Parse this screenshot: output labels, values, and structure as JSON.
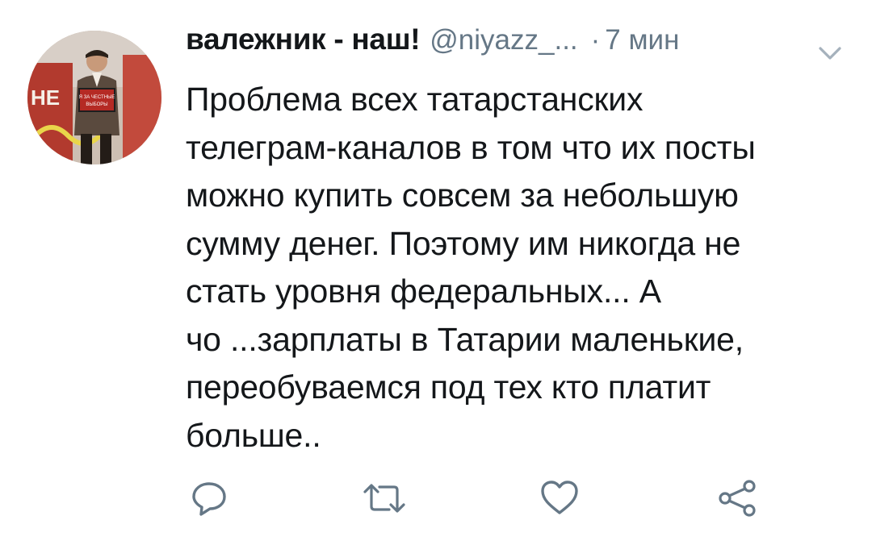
{
  "tweet": {
    "author_name": "валежник - наш!",
    "author_handle": "@niyazz_...",
    "separator": "·",
    "time": "7 мин",
    "text": "Проблема всех татарстанских\nтелеграм-каналов в том что их посты\nможно купить совсем за небольшую\nсумму денег. Поэтому им никогда не\nстать уровня федеральных... А\nчо ...зарплаты в Татарии маленькие,\nпереобуваемся под тех кто платит\nбольше..",
    "avatar_sign_text": "Я ЗА ЧЕСТНЫЕ ВЫБОРЫ",
    "avatar_banner_text": "НЕ"
  },
  "icons": [
    "reply-icon",
    "retweet-icon",
    "like-icon",
    "share-icon",
    "chevron-down-icon"
  ],
  "colors": {
    "icon_gray": "#657786",
    "text": "#14171a",
    "muted": "#657786"
  }
}
